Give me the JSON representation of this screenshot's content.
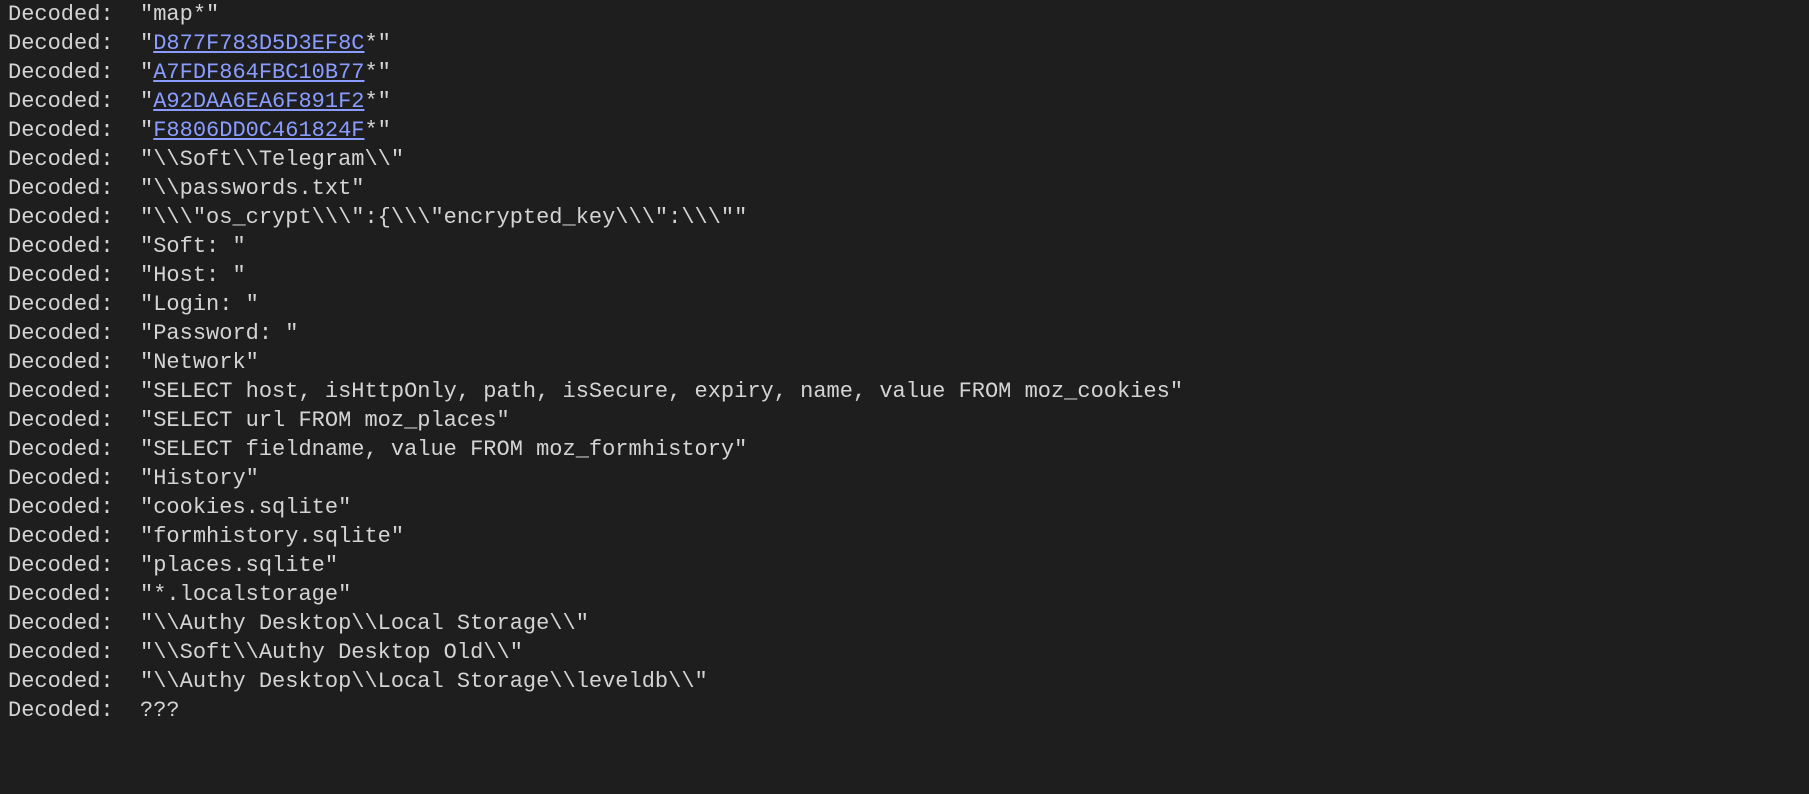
{
  "label": "Decoded:  ",
  "lines": [
    {
      "prefix": "\"",
      "link": null,
      "text": "map*",
      "suffix": "\""
    },
    {
      "prefix": "\"",
      "link": "D877F783D5D3EF8C",
      "text": "*",
      "suffix": "\""
    },
    {
      "prefix": "\"",
      "link": "A7FDF864FBC10B77",
      "text": "*",
      "suffix": "\""
    },
    {
      "prefix": "\"",
      "link": "A92DAA6EA6F891F2",
      "text": "*",
      "suffix": "\""
    },
    {
      "prefix": "\"",
      "link": "F8806DD0C461824F",
      "text": "*",
      "suffix": "\""
    },
    {
      "prefix": "\"",
      "link": null,
      "text": "\\\\Soft\\\\Telegram\\\\",
      "suffix": "\""
    },
    {
      "prefix": "\"",
      "link": null,
      "text": "\\\\passwords.txt",
      "suffix": "\""
    },
    {
      "prefix": "\"",
      "link": null,
      "text": "\\\\\\\"os_crypt\\\\\\\":{\\\\\\\"encrypted_key\\\\\\\":\\\\\\\"",
      "suffix": "\""
    },
    {
      "prefix": "\"",
      "link": null,
      "text": "Soft: ",
      "suffix": "\""
    },
    {
      "prefix": "\"",
      "link": null,
      "text": "Host: ",
      "suffix": "\""
    },
    {
      "prefix": "\"",
      "link": null,
      "text": "Login: ",
      "suffix": "\""
    },
    {
      "prefix": "\"",
      "link": null,
      "text": "Password: ",
      "suffix": "\""
    },
    {
      "prefix": "\"",
      "link": null,
      "text": "Network",
      "suffix": "\""
    },
    {
      "prefix": "\"",
      "link": null,
      "text": "SELECT host, isHttpOnly, path, isSecure, expiry, name, value FROM moz_cookies",
      "suffix": "\""
    },
    {
      "prefix": "\"",
      "link": null,
      "text": "SELECT url FROM moz_places",
      "suffix": "\""
    },
    {
      "prefix": "\"",
      "link": null,
      "text": "SELECT fieldname, value FROM moz_formhistory",
      "suffix": "\""
    },
    {
      "prefix": "\"",
      "link": null,
      "text": "History",
      "suffix": "\""
    },
    {
      "prefix": "\"",
      "link": null,
      "text": "cookies.sqlite",
      "suffix": "\""
    },
    {
      "prefix": "\"",
      "link": null,
      "text": "formhistory.sqlite",
      "suffix": "\""
    },
    {
      "prefix": "\"",
      "link": null,
      "text": "places.sqlite",
      "suffix": "\""
    },
    {
      "prefix": "\"",
      "link": null,
      "text": "*.localstorage",
      "suffix": "\""
    },
    {
      "prefix": "\"",
      "link": null,
      "text": "\\\\Authy Desktop\\\\Local Storage\\\\",
      "suffix": "\""
    },
    {
      "prefix": "\"",
      "link": null,
      "text": "\\\\Soft\\\\Authy Desktop Old\\\\",
      "suffix": "\""
    },
    {
      "prefix": "\"",
      "link": null,
      "text": "\\\\Authy Desktop\\\\Local Storage\\\\leveldb\\\\",
      "suffix": "\""
    },
    {
      "prefix": "",
      "link": null,
      "text": "???",
      "suffix": ""
    }
  ]
}
